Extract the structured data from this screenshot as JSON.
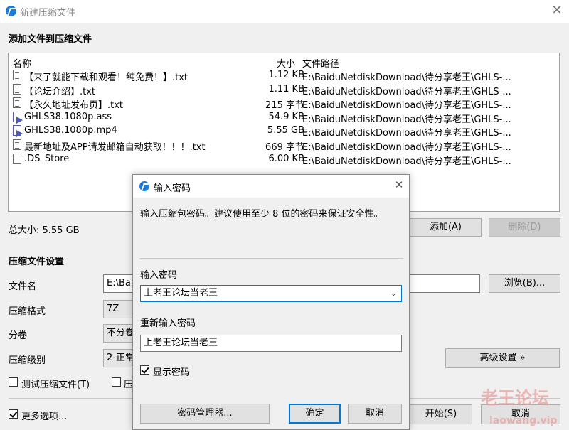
{
  "window": {
    "title": "新建压缩文件",
    "close_glyph": "✕"
  },
  "add_section": {
    "heading": "添加文件到压缩文件",
    "columns": {
      "name": "名称",
      "size": "大小",
      "path": "文件路径"
    },
    "files": [
      {
        "name": "【来了就能下载和观看！纯免费！】.txt",
        "size": "1.12 KB",
        "path": "E:\\BaiduNetdiskDownload\\待分享老王\\GHLS-...",
        "icon": "text-file-icon"
      },
      {
        "name": "【论坛介绍】.txt",
        "size": "1.11 KB",
        "path": "E:\\BaiduNetdiskDownload\\待分享老王\\GHLS-...",
        "icon": "text-file-icon"
      },
      {
        "name": "【永久地址发布页】.txt",
        "size": "215 字节",
        "path": "E:\\BaiduNetdiskDownload\\待分享老王\\GHLS-...",
        "icon": "text-file-icon"
      },
      {
        "name": "GHLS38.1080p.ass",
        "size": "54.9 KB",
        "path": "E:\\BaiduNetdiskDownload\\待分享老王\\GHLS-...",
        "icon": "media-file-icon"
      },
      {
        "name": "GHLS38.1080p.mp4",
        "size": "5.55 GB",
        "path": "E:\\BaiduNetdiskDownload\\待分享老王\\GHLS-...",
        "icon": "media-file-icon"
      },
      {
        "name": "最新地址及APP请发邮箱自动获取！！！.txt",
        "size": "669 字节",
        "path": "E:\\BaiduNetdiskDownload\\待分享老王\\GHLS-...",
        "icon": "text-file-icon"
      },
      {
        "name": ".DS_Store",
        "size": "6.00 KB",
        "path": "E:\\BaiduNetdiskDownload\\待分享老王\\GHLS-...",
        "icon": "blank-file-icon"
      }
    ],
    "total_size_label": "总大小: 5.55 GB",
    "add_button": "添加(A)",
    "delete_button": "删除(D)"
  },
  "settings": {
    "heading": "压缩文件设置",
    "filename_label": "文件名",
    "filename_value": "E:\\Baid",
    "browse_button": "浏览(B)...",
    "format_label": "压缩格式",
    "format_value": "7Z",
    "split_label": "分卷",
    "split_value": "不分卷",
    "level_label": "压缩级别",
    "level_value": "2-正常",
    "advanced_button": "高级设置 »",
    "test_checkbox": "测试压缩文件(T)",
    "second_checkbox_partial": "压",
    "more_options": "更多选项...",
    "start_button": "开始(S)",
    "cancel_button": "取消"
  },
  "dialog": {
    "title": "输入密码",
    "close_glyph": "✕",
    "description": "输入压缩包密码。建议使用至少 8 位的密码来保证安全性。",
    "password_label": "输入密码",
    "password_value": "上老王论坛当老王",
    "repeat_label": "重新输入密码",
    "repeat_value": "上老王论坛当老王",
    "show_password_label": "显示密码",
    "show_password_checked": true,
    "manager_button": "密码管理器...",
    "ok_button": "确定",
    "cancel_button": "取消"
  },
  "watermark": {
    "line1": "老王论坛",
    "line2": "laowang.vip"
  }
}
